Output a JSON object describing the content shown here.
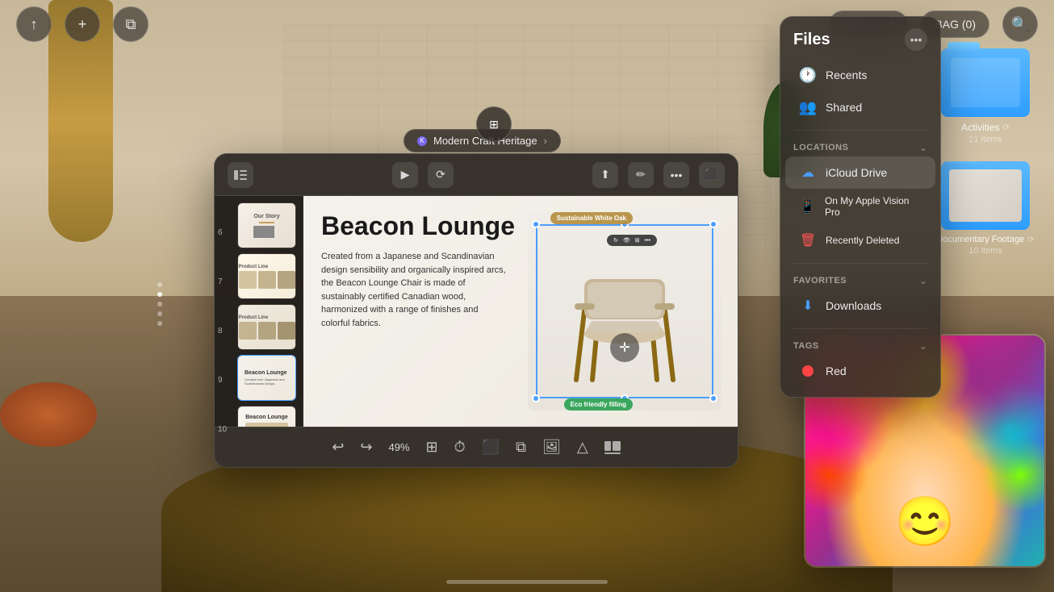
{
  "background": {
    "color": "#2A2018"
  },
  "topbar": {
    "share_label": "↑",
    "add_label": "+",
    "window_label": "⧉",
    "reach_label": "REACH ↗",
    "bag_label": "BAG (0)",
    "search_label": "🔍"
  },
  "keynote_title": "Modern Craft Heritage",
  "keynote": {
    "toolbar": {
      "present_icon": "▶",
      "share_icon": "⬆",
      "markup_icon": "✏",
      "more_icon": "•••",
      "inspector_icon": "⬛"
    },
    "slides": [
      {
        "num": "6",
        "label": "Our Story"
      },
      {
        "num": "7",
        "label": "Product Line"
      },
      {
        "num": "8",
        "label": "Product Line"
      },
      {
        "num": "9",
        "label": "Beacon Lounge"
      },
      {
        "num": "10",
        "label": "Beacon Lounge"
      }
    ],
    "active_slide": {
      "title": "Beacon Lounge",
      "body": "Created from a Japanese and Scandinavian design sensibility and organically inspired arcs, the Beacon Lounge Chair is made of sustainably certified Canadian wood, harmonized with a range of finishes and colorful fabrics.",
      "label_top": "Sustainable White Oak",
      "label_bottom": "Eco friendly filling"
    },
    "bottom": {
      "undo": "↩",
      "redo": "↪",
      "zoom": "49%",
      "table": "⊞",
      "clock": "⏱",
      "screen": "⬛",
      "copy": "⧉",
      "photo": "🖼",
      "shape": "△"
    }
  },
  "files_panel": {
    "title": "Files",
    "more_label": "•••",
    "recents_label": "Recents",
    "shared_label": "Shared",
    "locations_section": "Locations",
    "locations_chevron": "⌄",
    "icloud_label": "iCloud Drive",
    "apple_vision_label": "On My Apple Vision Pro",
    "recently_deleted_label": "Recently Deleted",
    "favorites_section": "Favorites",
    "favorites_chevron": "⌄",
    "downloads_label": "Downloads",
    "tags_section": "Tags",
    "tags_chevron": "⌄",
    "red_label": "Red"
  },
  "folder_activities": {
    "name": "Activities",
    "badge": "⟳",
    "count": "21 items"
  },
  "folder_documentary": {
    "name": "Documentary Footage",
    "badge": "⟳",
    "count": "10 items"
  }
}
